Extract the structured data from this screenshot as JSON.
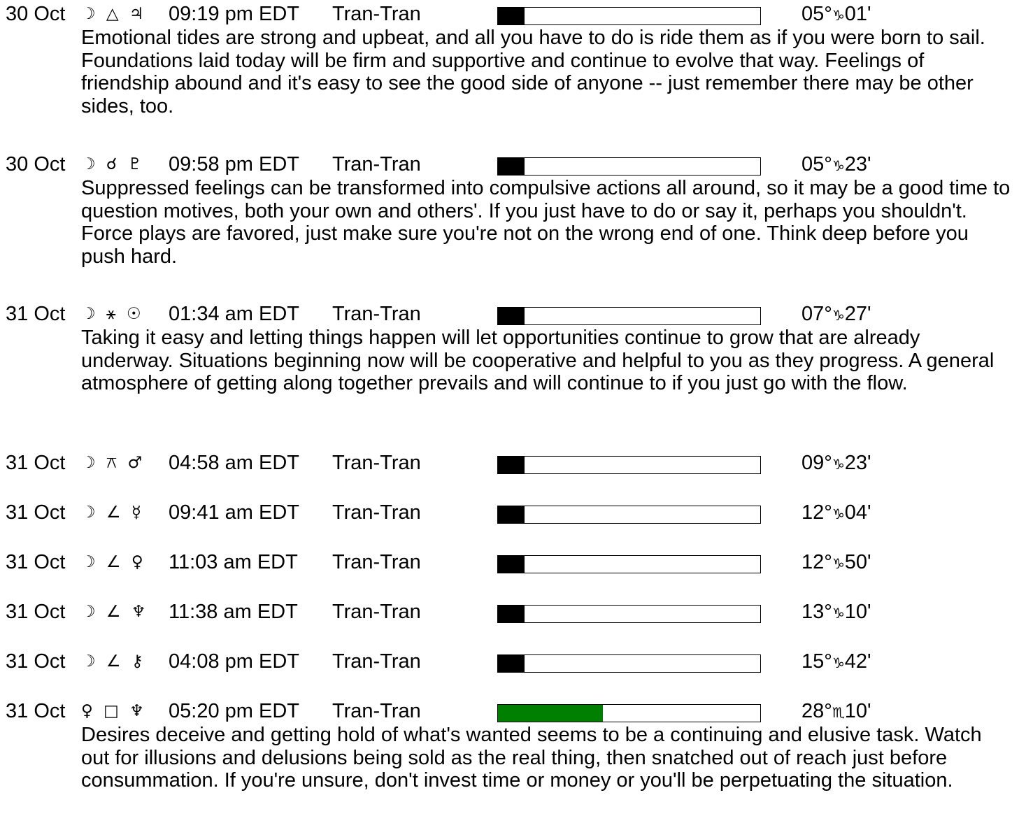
{
  "colors": {
    "bar_fill_default": "#000000",
    "bar_fill_highlight": "#008000",
    "bar_border": "#000000",
    "text": "#000000",
    "background": "#ffffff"
  },
  "entries": [
    {
      "date": "30 Oct",
      "glyphs": "☽ △ ♃",
      "glyph_names": [
        "moon-icon",
        "trine-icon",
        "jupiter-icon"
      ],
      "time": "09:19 pm EDT",
      "kind": "Tran-Tran",
      "strength": 0.1,
      "bar_color": "#000000",
      "degree": "05°",
      "sign": "♑",
      "minutes": "01'",
      "description": "Emotional tides are strong and upbeat, and all you have to do is ride them as if you were born to sail. Foundations laid today will be firm and supportive and continue to evolve that way. Feelings of friendship abound and it's easy to see the good side of anyone -- just remember there may be other sides, too."
    },
    {
      "date": "30 Oct",
      "glyphs": "☽ ☌ ♇",
      "glyph_names": [
        "moon-icon",
        "conjunction-icon",
        "pluto-icon"
      ],
      "time": "09:58 pm EDT",
      "kind": "Tran-Tran",
      "strength": 0.1,
      "bar_color": "#000000",
      "degree": "05°",
      "sign": "♑",
      "minutes": "23'",
      "description": "Suppressed feelings can be transformed into compulsive actions all around, so it may be a good time to question motives, both your own and others'. If you just have to do or say it, perhaps you shouldn't. Force plays are favored, just make sure you're not on the wrong end of one. Think deep before you push hard."
    },
    {
      "date": "31 Oct",
      "glyphs": "☽ ⚹ ☉",
      "glyph_names": [
        "moon-icon",
        "sextile-icon",
        "sun-icon"
      ],
      "time": "01:34 am EDT",
      "kind": "Tran-Tran",
      "strength": 0.1,
      "bar_color": "#000000",
      "degree": "07°",
      "sign": "♑",
      "minutes": "27'",
      "description": "Taking it easy and letting things happen will let opportunities continue to grow that are already underway. Situations beginning now will be cooperative and helpful to you as they progress. A general atmosphere of getting along together prevails and will continue to if you just go with the flow."
    },
    {
      "date": "31 Oct",
      "glyphs": "☽ ⚻ ♂",
      "glyph_names": [
        "moon-icon",
        "quincunx-icon",
        "mars-icon"
      ],
      "time": "04:58 am EDT",
      "kind": "Tran-Tran",
      "strength": 0.1,
      "bar_color": "#000000",
      "degree": "09°",
      "sign": "♑",
      "minutes": "23'",
      "description": ""
    },
    {
      "date": "31 Oct",
      "glyphs": "☽ ∠ ☿",
      "glyph_names": [
        "moon-icon",
        "semisquare-icon",
        "mercury-icon"
      ],
      "time": "09:41 am EDT",
      "kind": "Tran-Tran",
      "strength": 0.1,
      "bar_color": "#000000",
      "degree": "12°",
      "sign": "♑",
      "minutes": "04'",
      "description": ""
    },
    {
      "date": "31 Oct",
      "glyphs": "☽ ∠ ♀",
      "glyph_names": [
        "moon-icon",
        "semisquare-icon",
        "venus-icon"
      ],
      "time": "11:03 am EDT",
      "kind": "Tran-Tran",
      "strength": 0.1,
      "bar_color": "#000000",
      "degree": "12°",
      "sign": "♑",
      "minutes": "50'",
      "description": ""
    },
    {
      "date": "31 Oct",
      "glyphs": "☽ ∠ ♆",
      "glyph_names": [
        "moon-icon",
        "semisquare-icon",
        "neptune-icon"
      ],
      "time": "11:38 am EDT",
      "kind": "Tran-Tran",
      "strength": 0.1,
      "bar_color": "#000000",
      "degree": "13°",
      "sign": "♑",
      "minutes": "10'",
      "description": ""
    },
    {
      "date": "31 Oct",
      "glyphs": "☽ ∠ ⚷",
      "glyph_names": [
        "moon-icon",
        "semisquare-icon",
        "chiron-icon"
      ],
      "time": "04:08 pm EDT",
      "kind": "Tran-Tran",
      "strength": 0.1,
      "bar_color": "#000000",
      "degree": "15°",
      "sign": "♑",
      "minutes": "42'",
      "description": ""
    },
    {
      "date": "31 Oct",
      "glyphs": "♀ □ ♆",
      "glyph_names": [
        "venus-icon",
        "square-icon",
        "neptune-icon"
      ],
      "time": "05:20 pm EDT",
      "kind": "Tran-Tran",
      "strength": 0.4,
      "bar_color": "#008000",
      "degree": "28°",
      "sign": "♏",
      "minutes": "10'",
      "description": "Desires deceive and getting hold of what's wanted seems to be a continuing and elusive task. Watch out for illusions and delusions being sold as the real thing, then snatched out of reach just before consummation. If you're unsure, don't invest time or money or you'll be perpetuating the situation."
    }
  ]
}
